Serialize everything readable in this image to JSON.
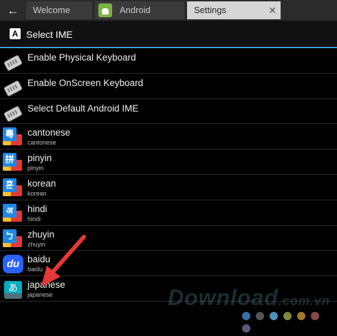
{
  "tabs": {
    "welcome": "Welcome",
    "android": "Android",
    "settings": "Settings"
  },
  "header": {
    "title": "Select IME",
    "icon_letter": "A"
  },
  "list": [
    {
      "title": "Enable Physical Keyboard",
      "subtitle": "",
      "icon": "keyboard-icon"
    },
    {
      "title": "Enable OnScreen Keyboard",
      "subtitle": "",
      "icon": "keyboard-icon"
    },
    {
      "title": "Select Default Android IME",
      "subtitle": "",
      "icon": "keyboard-icon"
    },
    {
      "title": "cantonese",
      "subtitle": "cantonese",
      "icon": "cantonese-icon",
      "glyph": "粵",
      "color": "#1e88e5"
    },
    {
      "title": "pinyin",
      "subtitle": "pinyin",
      "icon": "pinyin-icon",
      "glyph": "拼",
      "color": "#1e88e5"
    },
    {
      "title": "korean",
      "subtitle": "korean",
      "icon": "korean-icon",
      "glyph": "훈",
      "color": "#1e88e5"
    },
    {
      "title": "hindi",
      "subtitle": "hindi",
      "icon": "hindi-icon",
      "glyph": "अ",
      "color": "#1e88e5"
    },
    {
      "title": "zhuyin",
      "subtitle": "zhuyin",
      "icon": "zhuyin-icon",
      "glyph": "ㄅ",
      "color": "#1e88e5"
    },
    {
      "title": "baidu",
      "subtitle": "baidu",
      "icon": "baidu-icon",
      "glyph": "du"
    },
    {
      "title": "japanese",
      "subtitle": "japanese",
      "icon": "japanese-icon",
      "glyph": "あ"
    }
  ],
  "watermark": {
    "main": "Download",
    "suffix": ".com.vn"
  },
  "colors": {
    "accent": "#3aa0d6",
    "arrow": "#e53935"
  },
  "dot_colors": [
    "#3a6ea5",
    "#555555",
    "#4a90b8",
    "#7a8a3a",
    "#a07a2a",
    "#8a4a4a",
    "#5a5a7a"
  ]
}
